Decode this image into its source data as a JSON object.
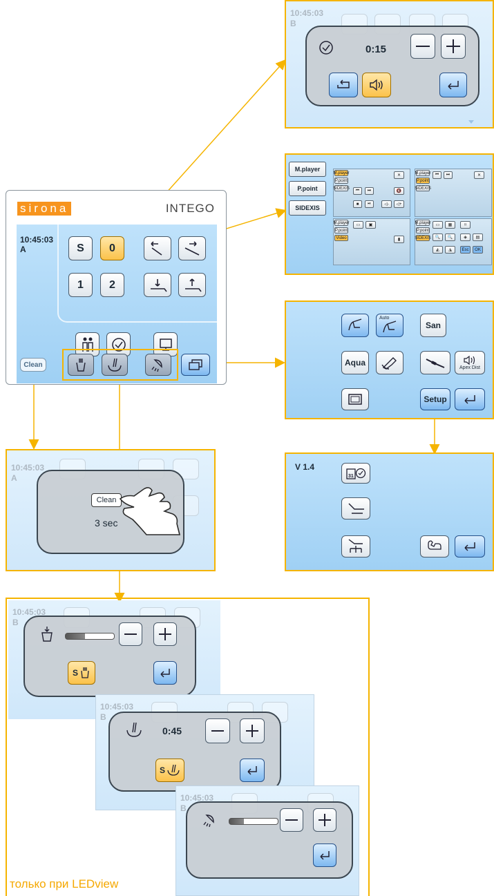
{
  "device": {
    "brand": "sirona",
    "model": "INTEGO",
    "clock": "10:45:03",
    "mode": "A",
    "buttons": {
      "s": "S",
      "zero": "0",
      "one": "1",
      "two": "2"
    },
    "clean_label": "Clean"
  },
  "timer_panel": {
    "clock": "10:45:03",
    "mode": "B",
    "time": "0:15"
  },
  "media_panel": {
    "tabs": [
      "M.player",
      "P.point",
      "SIDEXIS"
    ],
    "mini_labels": {
      "mplayer": "M.player",
      "ppoint": "P.point",
      "sidexis": "SIDEXIS",
      "video": "Video",
      "esc": "Esc",
      "ok": "OK"
    }
  },
  "menu_panel": {
    "auto": "Auto",
    "san": "San",
    "aqua": "Aqua",
    "apex_dist": "Apex Dist",
    "setup": "Setup"
  },
  "setup_panel": {
    "version": "V 1.4"
  },
  "clean_panel": {
    "clock": "10:45:03",
    "mode": "A",
    "clean_label": "Clean",
    "hint": "3 sec"
  },
  "sub_panels": {
    "cup": {
      "clock": "10:45:03",
      "mode": "B",
      "s_label": "S"
    },
    "rinse": {
      "clock": "10:45:03",
      "mode": "B",
      "time": "0:45",
      "s_label": "S"
    },
    "light": {
      "clock": "10:45:03",
      "mode": "B"
    }
  },
  "footnote": "только при LEDview",
  "colors": {
    "arrow": "#f5b400",
    "brand_orange": "#f7941d",
    "screen_blue": "#a8d6f6"
  }
}
